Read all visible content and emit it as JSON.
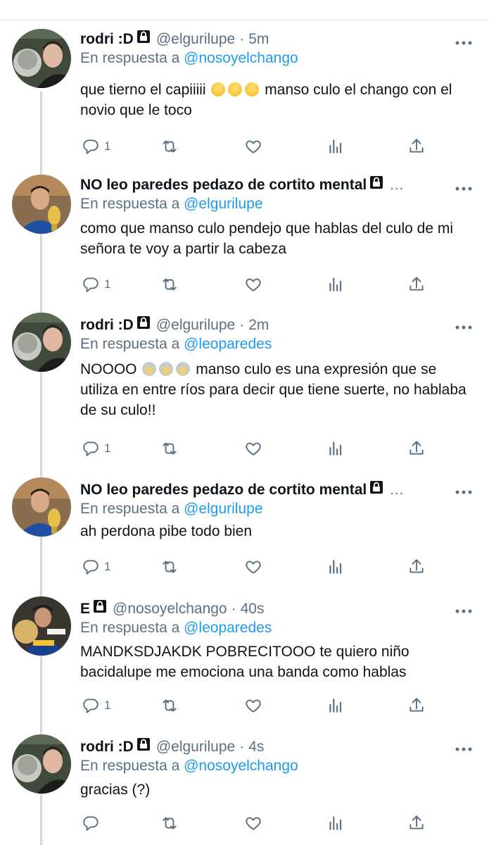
{
  "tweets": [
    {
      "name": "rodri :D",
      "handle": "@elgurilupe",
      "sep": "·",
      "time": "5m",
      "reply_prefix": "En respuesta a",
      "reply_to": "@nosoyelchango",
      "text_before": "que tierno el capiiiii",
      "emojis": [
        "🥲",
        "🥲",
        "🥲"
      ],
      "text_after": "manso culo el chango con el novio que le toco",
      "reply_count": "1",
      "avatar": "rodri"
    },
    {
      "name": "NO leo paredes pedazo de cortito mental",
      "handle": "",
      "sep": "",
      "time": "",
      "truncated": "…",
      "reply_prefix": "En respuesta a",
      "reply_to": "@elgurilupe",
      "text_before": "como que manso culo pendejo que hablas del culo de mi señora te voy a partir la cabeza",
      "emojis": [],
      "text_after": "",
      "reply_count": "1",
      "avatar": "leo"
    },
    {
      "name": "rodri :D",
      "handle": "@elgurilupe",
      "sep": "·",
      "time": "2m",
      "reply_prefix": "En respuesta a",
      "reply_to": "@leoparedes",
      "text_before": "NOOOO",
      "emojis": [
        "😰",
        "😰",
        "😰"
      ],
      "text_after": "manso culo es una expresión que se utiliza en entre ríos para decir que tiene suerte, no hablaba de su culo!!",
      "reply_count": "1",
      "avatar": "rodri"
    },
    {
      "name": "NO leo paredes pedazo de cortito mental",
      "handle": "",
      "sep": "",
      "time": "",
      "truncated": "…",
      "reply_prefix": "En respuesta a",
      "reply_to": "@elgurilupe",
      "text_before": "ah perdona pibe todo bien",
      "emojis": [],
      "text_after": "",
      "reply_count": "1",
      "avatar": "leo"
    },
    {
      "name": "E",
      "handle": "@nosoyelchango",
      "sep": "·",
      "time": "40s",
      "reply_prefix": "En respuesta a",
      "reply_to": "@leoparedes",
      "text_before": "MANDKSDJAKDK POBRECITOOO te quiero niño bacidalupe me emociona una banda como hablas",
      "emojis": [],
      "text_after": "",
      "reply_count": "1",
      "avatar": "e"
    },
    {
      "name": "rodri :D",
      "handle": "@elgurilupe",
      "sep": "·",
      "time": "4s",
      "reply_prefix": "En respuesta a",
      "reply_to": "@nosoyelchango",
      "text_before": "gracias (?)",
      "emojis": [],
      "text_after": "",
      "reply_count": "",
      "avatar": "rodri"
    }
  ],
  "icons": {
    "reply": "reply-icon",
    "retweet": "retweet-icon",
    "like": "like-icon",
    "stats": "stats-icon",
    "share": "share-icon",
    "more": "more-icon",
    "lock": "lock-icon"
  },
  "colors": {
    "link": "#1d9bf0",
    "secondary": "#5b7083",
    "text": "#0f1419"
  }
}
